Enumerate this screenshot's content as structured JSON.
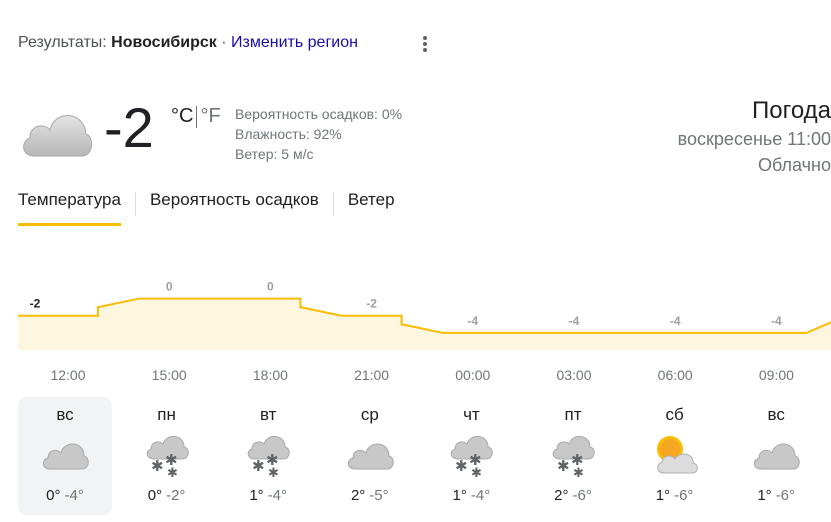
{
  "header": {
    "prefix": "Результаты: ",
    "city": "Новосибирск",
    "separator": " · ",
    "change_region": "Изменить регион"
  },
  "current": {
    "icon": "cloud-icon",
    "temp": "-2",
    "unit_c": "°C",
    "unit_f": "°F",
    "precipitation": "Вероятность осадков: 0%",
    "humidity": "Влажность: 92%",
    "wind": "Ветер: 5 м/с"
  },
  "right_info": {
    "title": "Погода",
    "when": "воскресенье 11:00",
    "condition": "Облачно"
  },
  "tabs": [
    {
      "label": "Температура",
      "active": true
    },
    {
      "label": "Вероятность осадков",
      "active": false
    },
    {
      "label": "Ветер",
      "active": false
    }
  ],
  "colors": {
    "accent": "#fbbc04",
    "chart_fill": "#fef7e0",
    "link": "#1a0dab"
  },
  "chart_data": {
    "type": "area",
    "x": [
      "12:00",
      "15:00",
      "18:00",
      "21:00",
      "00:00",
      "03:00",
      "06:00",
      "09:00"
    ],
    "labels": [
      "-2",
      "0",
      "0",
      "-2",
      "-4",
      "-4",
      "-4",
      "-4"
    ],
    "values": [
      -2,
      0,
      0,
      -2,
      -4,
      -4,
      -4,
      -4
    ],
    "ylim": [
      -6,
      1
    ],
    "grid": false
  },
  "days": [
    {
      "name": "вс",
      "icon": "cloud-icon",
      "hi": "0°",
      "lo": "-4°",
      "selected": true
    },
    {
      "name": "пн",
      "icon": "snow-icon",
      "hi": "0°",
      "lo": "-2°",
      "selected": false
    },
    {
      "name": "вт",
      "icon": "snow-icon",
      "hi": "1°",
      "lo": "-4°",
      "selected": false
    },
    {
      "name": "ср",
      "icon": "cloud-icon",
      "hi": "2°",
      "lo": "-5°",
      "selected": false
    },
    {
      "name": "чт",
      "icon": "snow-icon",
      "hi": "1°",
      "lo": "-4°",
      "selected": false
    },
    {
      "name": "пт",
      "icon": "snow-icon",
      "hi": "2°",
      "lo": "-6°",
      "selected": false
    },
    {
      "name": "сб",
      "icon": "partly-sunny-icon",
      "hi": "1°",
      "lo": "-6°",
      "selected": false
    },
    {
      "name": "вс",
      "icon": "cloud-icon",
      "hi": "1°",
      "lo": "-6°",
      "selected": false
    }
  ]
}
